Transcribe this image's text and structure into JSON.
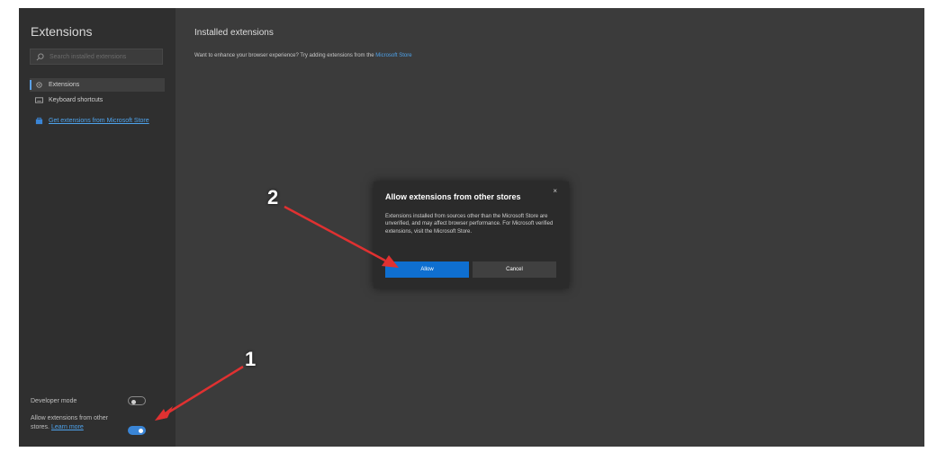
{
  "sidebar": {
    "title": "Extensions",
    "search_placeholder": "Search installed extensions",
    "items": [
      {
        "label": "Extensions",
        "icon": "gear-icon"
      },
      {
        "label": "Keyboard shortcuts",
        "icon": "keyboard-icon"
      }
    ],
    "store_link": "Get extensions from Microsoft Store",
    "developer_mode": {
      "label": "Developer mode",
      "on": false
    },
    "allow_other_stores": {
      "label": "Allow extensions from other stores.",
      "link": "Learn more",
      "on": true
    }
  },
  "main": {
    "title": "Installed extensions",
    "promo_text": "Want to enhance your browser experience? Try adding extensions from the",
    "promo_link": "Microsoft Store"
  },
  "dialog": {
    "title": "Allow extensions from other stores",
    "close": "×",
    "body": "Extensions installed from sources other than the Microsoft Store are unverified, and may affect browser performance. For Microsoft verified extensions, visit the Microsoft Store.",
    "allow": "Allow",
    "cancel": "Cancel"
  },
  "annotations": {
    "step1": "1",
    "step2": "2",
    "arrow_color": "#e03131"
  }
}
